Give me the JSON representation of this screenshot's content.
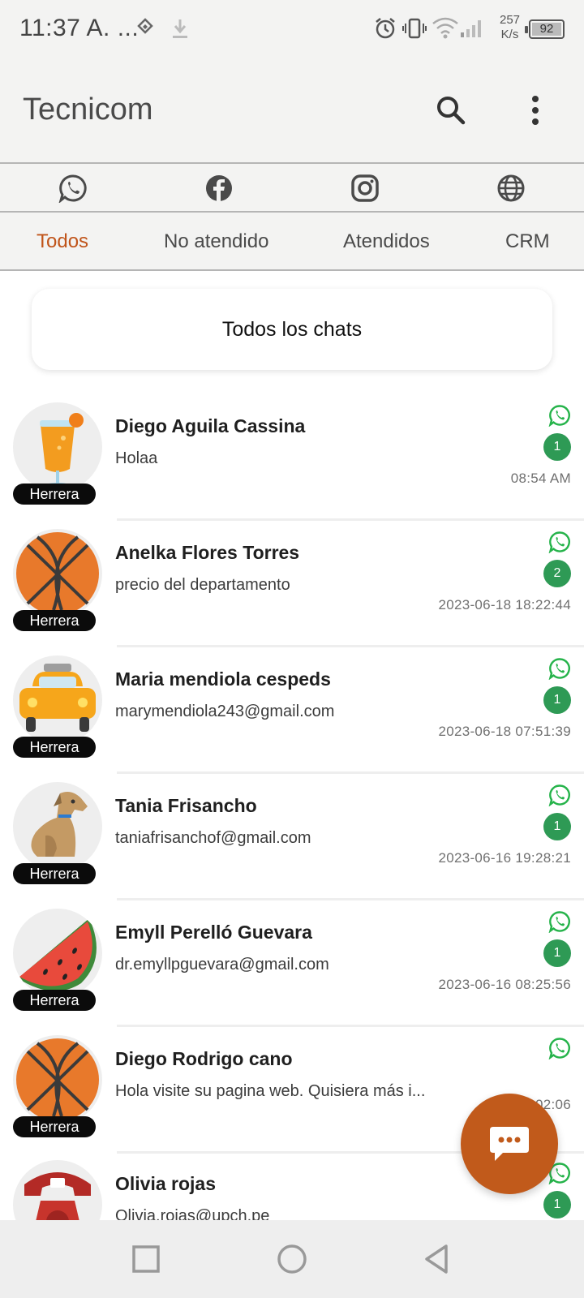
{
  "status_bar": {
    "time": "11:37 A. ...",
    "speed_value": "257",
    "speed_unit": "K/s",
    "battery": "92",
    "icons": [
      "location-icon",
      "download-icon",
      "alarm-icon",
      "vibrate-icon",
      "wifi-icon",
      "signal-icon",
      "battery-icon"
    ]
  },
  "app_bar": {
    "title": "Tecnicom",
    "icons": [
      "search-icon",
      "more-vert-icon"
    ]
  },
  "channels": [
    "whatsapp-icon",
    "facebook-icon",
    "instagram-icon",
    "web-globe-icon"
  ],
  "tabs": [
    {
      "label": "Todos",
      "active": true
    },
    {
      "label": "No atendido",
      "active": false
    },
    {
      "label": "Atendidos",
      "active": false
    },
    {
      "label": "CRM",
      "active": false
    }
  ],
  "filter": {
    "label": "Todos los chats"
  },
  "chats": [
    {
      "name": "Diego Aguila Cassina",
      "message": "Holaa",
      "time": "08:54 AM",
      "unread": "1",
      "tag": "Herrera",
      "avatar": "drink-avatar",
      "channel": "whatsapp-icon"
    },
    {
      "name": "Anelka Flores Torres",
      "message": "precio del departamento",
      "time": "2023-06-18 18:22:44",
      "unread": "2",
      "tag": "Herrera",
      "avatar": "basketball-avatar",
      "channel": "whatsapp-icon"
    },
    {
      "name": "Maria mendiola cespeds",
      "message": "marymendiola243@gmail.com",
      "time": "2023-06-18 07:51:39",
      "unread": "1",
      "tag": "Herrera",
      "avatar": "taxi-avatar",
      "channel": "whatsapp-icon"
    },
    {
      "name": "Tania Frisancho",
      "message": "taniafrisanchof@gmail.com",
      "time": "2023-06-16 19:28:21",
      "unread": "1",
      "tag": "Herrera",
      "avatar": "dog-avatar",
      "channel": "whatsapp-icon"
    },
    {
      "name": "Emyll Perelló Guevara",
      "message": "dr.emyllpguevara@gmail.com",
      "time": "2023-06-16 08:25:56",
      "unread": "1",
      "tag": "Herrera",
      "avatar": "watermelon-avatar",
      "channel": "whatsapp-icon"
    },
    {
      "name": "Diego Rodrigo cano",
      "message": "Hola visite su pagina web. Quisiera más i...",
      "time": "2023-0   02:06",
      "unread": "",
      "tag": "Herrera",
      "avatar": "basketball-avatar",
      "channel": "whatsapp-icon"
    },
    {
      "name": "Olivia rojas",
      "message": "Olivia.rojas@upch.pe",
      "time": "",
      "unread": "1",
      "tag": "",
      "avatar": "telephone-avatar",
      "channel": "whatsapp-icon"
    }
  ],
  "fab": {
    "icon": "chat-bubble-icon"
  },
  "nav_bar": {
    "icons": [
      "recents-icon",
      "home-icon",
      "back-icon"
    ]
  },
  "colors": {
    "accent": "#c0541a",
    "badge_green": "#2e9a55",
    "whatsapp_green": "#25b34a",
    "tag_black": "#0b0b0b"
  }
}
